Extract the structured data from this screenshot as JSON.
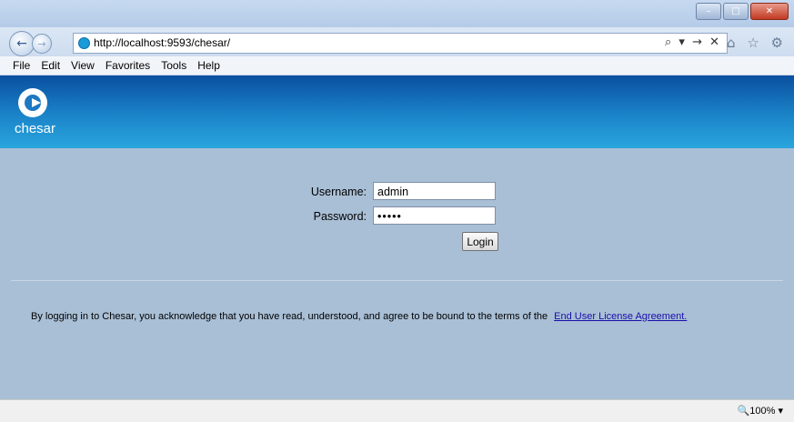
{
  "browser": {
    "url": "http://localhost:9593/chesar/",
    "address_tools": "⌕ ▾ → ✕",
    "right_icons": "⌂ ☆ ⚙",
    "window_controls": {
      "minimize": "–",
      "maximize": "□",
      "close": "✕"
    },
    "menu": [
      "File",
      "Edit",
      "View",
      "Favorites",
      "Tools",
      "Help"
    ],
    "zoom": "🔍100%  ▾"
  },
  "header": {
    "logo_text": "chesar"
  },
  "login": {
    "username_label": "Username:",
    "username_value": "admin",
    "password_label": "Password:",
    "password_value": "•••••",
    "login_button": "Login"
  },
  "eula": {
    "text": "By logging in to Chesar, you acknowledge that you have read, understood, and agree to be bound to the terms of the",
    "link": "End User License Agreement."
  }
}
